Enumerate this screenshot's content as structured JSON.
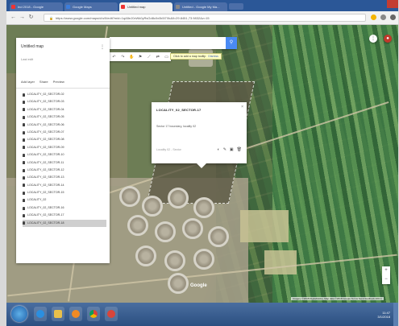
{
  "browser": {
    "tabs": [
      {
        "label": "Ind 2018 - Google",
        "active": false
      },
      {
        "label": "Google Maps",
        "active": false
      },
      {
        "label": "Untitled map",
        "active": true
      },
      {
        "label": "Untitled - Google My Ma...",
        "active": false
      }
    ],
    "url": "https://www.google.com/maps/d/u/0/edit?mid=1qA5eJ0xWk0yRsGd8c0x0k5l7Xk&ll=29.8451,73.9832&z=15"
  },
  "sidebar": {
    "title": "Untitled map",
    "subtitle": "Last edit",
    "actions": [
      "Add layer",
      "Share",
      "Preview"
    ],
    "items": [
      "LOCALITY_02_SECTOR-02",
      "LOCALITY_02_SECTOR-03",
      "LOCALITY_02_SECTOR-04",
      "LOCALITY_02_SECTOR-05",
      "LOCALITY_02_SECTOR-06",
      "LOCALITY_02_SECTOR-07",
      "LOCALITY_02_SECTOR-08",
      "LOCALITY_02_SECTOR-09",
      "LOCALITY_02_SECTOR-10",
      "LOCALITY_02_SECTOR-11",
      "LOCALITY_02_SECTOR-12",
      "LOCALITY_02_SECTOR-13",
      "LOCALITY_02_SECTOR-14",
      "LOCALITY_02_SECTOR-15",
      "LOCALITY_02",
      "LOCALITY_02_SECTOR-16",
      "LOCALITY_02_SECTOR-17",
      "LOCALITY_02_SECTOR-18"
    ],
    "selected_index": 17
  },
  "search": {
    "placeholder": ""
  },
  "tooltip": {
    "text": "Click to add a map tooltip",
    "link": "Dismiss"
  },
  "popup": {
    "title": "LOCALITY_02_SECTOR-17",
    "description": "Sector 17 boundary, locality 02",
    "footer": "Locality 02 - Sector",
    "close": "×"
  },
  "map": {
    "logo": "Google",
    "attribution": "Imagery ©2018 DigitalGlobe, Map data ©2018 Google   Terms   Send feedback   200 m"
  },
  "taskbar": {
    "time": "11:47",
    "date": "3/1/2018"
  }
}
